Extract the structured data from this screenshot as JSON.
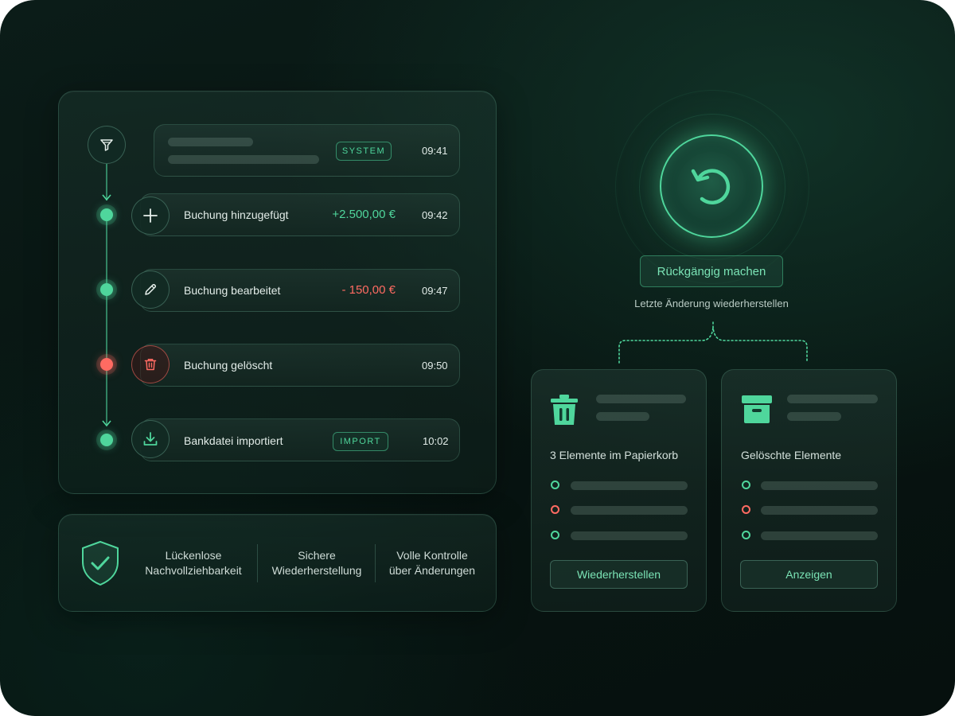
{
  "colors": {
    "accent": "#4fd69c",
    "danger": "#ff6b62",
    "background": "#081512"
  },
  "timeline": {
    "filter_icon": "filter-icon",
    "events": [
      {
        "icon": "skeleton",
        "badge": "SYSTEM",
        "time": "09:41"
      },
      {
        "icon": "plus-icon",
        "label": "Buchung hinzugefügt",
        "amount": "+2.500,00 €",
        "time": "09:42",
        "status": "ok"
      },
      {
        "icon": "pencil-icon",
        "label": "Buchung bearbeitet",
        "amount": "- 150,00 €",
        "time": "09:47",
        "status": "ok"
      },
      {
        "icon": "trash-icon",
        "label": "Buchung gelöscht",
        "time": "09:50",
        "status": "deleted"
      },
      {
        "icon": "download-icon",
        "label": "Bankdatei importiert",
        "badge": "IMPORT",
        "time": "10:02",
        "status": "ok"
      }
    ]
  },
  "features": {
    "icon": "shield-check-icon",
    "items": [
      {
        "line1": "Lückenlose",
        "line2": "Nachvollziehbarkeit"
      },
      {
        "line1": "Sichere",
        "line2": "Wiederherstellung"
      },
      {
        "line1": "Volle Kontrolle",
        "line2": "über Änderungen"
      }
    ]
  },
  "undo": {
    "icon": "undo-icon",
    "button_label": "Rückgängig machen",
    "subtitle": "Letzte Änderung wiederherstellen"
  },
  "cards": [
    {
      "icon": "trash-icon",
      "label": "3 Elemente im Papierkorb",
      "bullets": [
        "ok",
        "deleted",
        "ok"
      ],
      "button": "Wiederherstellen"
    },
    {
      "icon": "archive-icon",
      "label": "Gelöschte Elemente",
      "bullets": [
        "ok",
        "deleted",
        "ok"
      ],
      "button": "Anzeigen"
    }
  ]
}
